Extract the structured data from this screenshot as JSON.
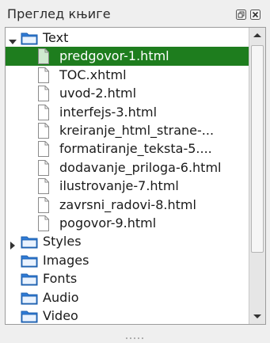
{
  "panel": {
    "title": "Преглед књиге"
  },
  "colors": {
    "selection": "#1e7d1e",
    "folder": "#2f7bd6"
  },
  "tree": [
    {
      "label": "Text",
      "type": "folder",
      "expanded": true,
      "level": 0
    },
    {
      "label": "predgovor-1.html",
      "type": "file",
      "level": 1,
      "selected": true
    },
    {
      "label": "TOC.xhtml",
      "type": "file",
      "level": 1
    },
    {
      "label": "uvod-2.html",
      "type": "file",
      "level": 1
    },
    {
      "label": "interfejs-3.html",
      "type": "file",
      "level": 1
    },
    {
      "label": "kreiranje_html_strane-...",
      "type": "file",
      "level": 1
    },
    {
      "label": "formatiranje_teksta-5....",
      "type": "file",
      "level": 1
    },
    {
      "label": "dodavanje_priloga-6.html",
      "type": "file",
      "level": 1
    },
    {
      "label": "ilustrovanje-7.html",
      "type": "file",
      "level": 1
    },
    {
      "label": "zavrsni_radovi-8.html",
      "type": "file",
      "level": 1
    },
    {
      "label": "pogovor-9.html",
      "type": "file",
      "level": 1
    },
    {
      "label": "Styles",
      "type": "folder",
      "expanded": false,
      "level": 0,
      "hasChildren": true
    },
    {
      "label": "Images",
      "type": "folder",
      "level": 0
    },
    {
      "label": "Fonts",
      "type": "folder",
      "level": 0
    },
    {
      "label": "Audio",
      "type": "folder",
      "level": 0
    },
    {
      "label": "Video",
      "type": "folder",
      "level": 0
    }
  ],
  "icons": {
    "float": "float-window-icon",
    "close": "close-panel-icon",
    "folder": "folder-icon",
    "file": "file-icon"
  }
}
